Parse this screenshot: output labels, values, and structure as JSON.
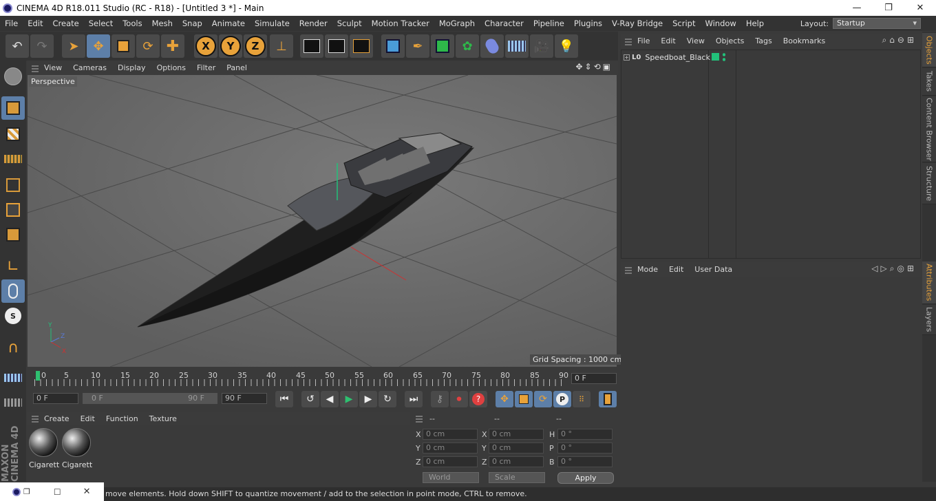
{
  "window": {
    "title": "CINEMA 4D R18.011 Studio (RC - R18) - [Untitled 3 *] - Main",
    "controls": [
      "—",
      "❐",
      "✕"
    ]
  },
  "menubar": {
    "items": [
      "File",
      "Edit",
      "Create",
      "Select",
      "Tools",
      "Mesh",
      "Snap",
      "Animate",
      "Simulate",
      "Render",
      "Sculpt",
      "Motion Tracker",
      "MoGraph",
      "Character",
      "Pipeline",
      "Plugins",
      "V-Ray Bridge",
      "Script",
      "Window",
      "Help"
    ],
    "layout_label": "Layout:",
    "layout_value": "Startup"
  },
  "toolbar": {
    "axis_x": "X",
    "axis_y": "Y",
    "axis_z": "Z"
  },
  "viewport": {
    "menu": [
      "View",
      "Cameras",
      "Display",
      "Options",
      "Filter",
      "Panel"
    ],
    "camera_label": "Perspective",
    "grid_spacing": "Grid Spacing : 1000 cm",
    "axis_labels": {
      "y": "Y",
      "z": "Z",
      "x": "X"
    }
  },
  "timeline": {
    "ticks": [
      "0",
      "5",
      "10",
      "15",
      "20",
      "25",
      "30",
      "35",
      "40",
      "45",
      "50",
      "55",
      "60",
      "65",
      "70",
      "75",
      "80",
      "85",
      "90"
    ],
    "current_frame": "0 F",
    "start_field": "0 F",
    "range_start": "0 F",
    "range_end": "90 F",
    "end_field": "90 F"
  },
  "material_manager": {
    "menu": [
      "Create",
      "Edit",
      "Function",
      "Texture"
    ],
    "materials": [
      "Cigarett",
      "Cigarett"
    ]
  },
  "coordinates": {
    "headers": [
      "--",
      "--",
      "--"
    ],
    "rows": [
      {
        "l1": "X",
        "v1": "0 cm",
        "l2": "X",
        "v2": "0 cm",
        "l3": "H",
        "v3": "0 °"
      },
      {
        "l1": "Y",
        "v1": "0 cm",
        "l2": "Y",
        "v2": "0 cm",
        "l3": "P",
        "v3": "0 °"
      },
      {
        "l1": "Z",
        "v1": "0 cm",
        "l2": "Z",
        "v2": "0 cm",
        "l3": "B",
        "v3": "0 °"
      }
    ],
    "mode_dropdown": "World",
    "scale_dropdown": "Scale",
    "apply": "Apply"
  },
  "object_manager": {
    "menu": [
      "File",
      "Edit",
      "View",
      "Objects",
      "Tags",
      "Bookmarks"
    ],
    "objects": [
      {
        "layer": "L0",
        "name": "Speedboat_Black"
      }
    ]
  },
  "attribute_manager": {
    "menu": [
      "Mode",
      "Edit",
      "User Data"
    ]
  },
  "right_tabs": [
    "Objects",
    "Takes",
    "Content Browser",
    "Structure",
    "Attributes",
    "Layers"
  ],
  "branding": "MAXON CINEMA 4D",
  "status": {
    "message": "move elements. Hold down SHIFT to quantize movement / add to the selection in point mode, CTRL to remove."
  },
  "colors": {
    "accent_orange": "#e8a23a",
    "highlight_blue": "#5d7fa8",
    "active_green": "#22c07a"
  }
}
